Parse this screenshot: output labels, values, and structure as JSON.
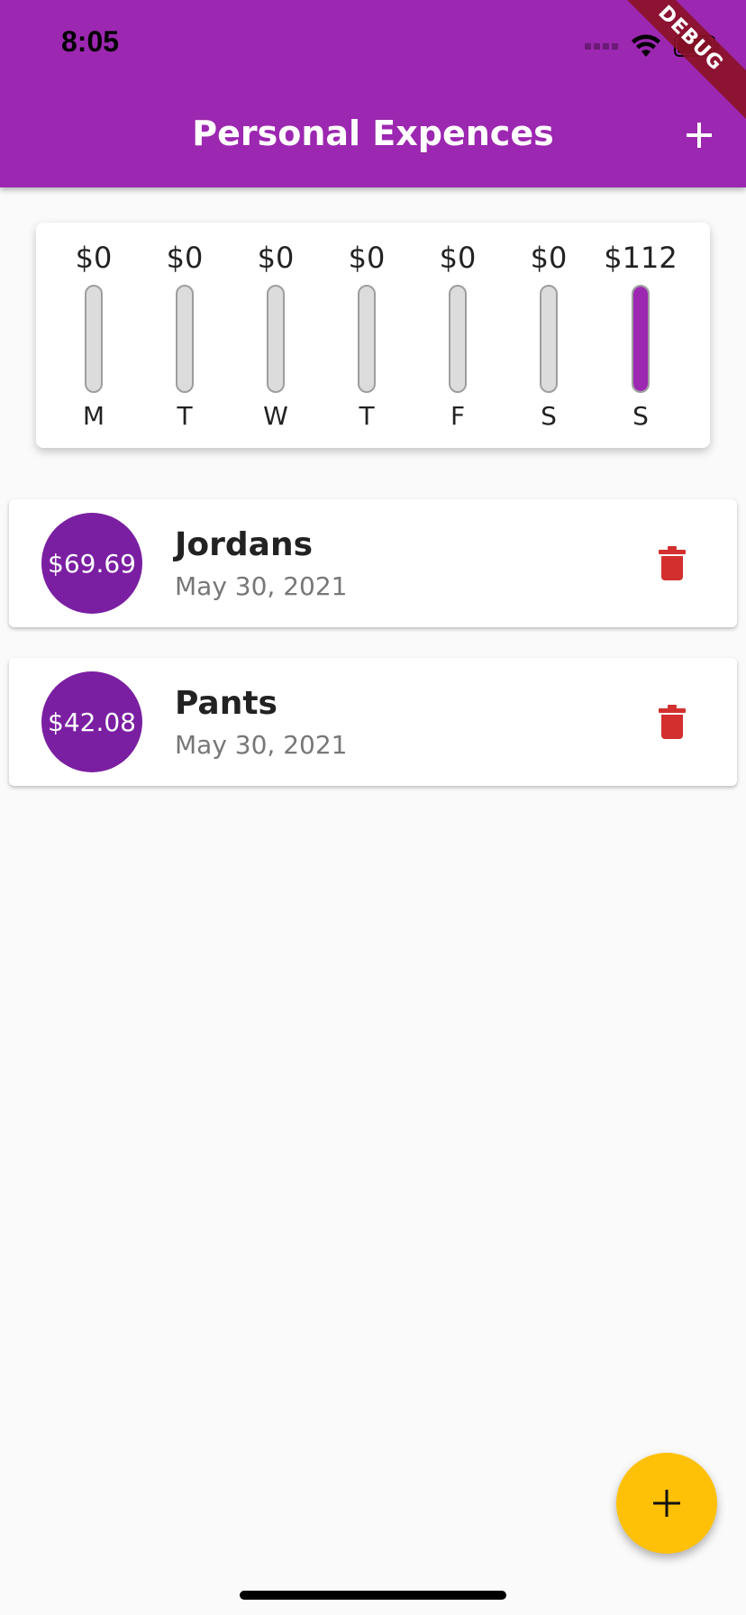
{
  "status_bar": {
    "time": "8:05"
  },
  "app_bar": {
    "title": "Personal Expences",
    "add_icon": "plus-icon"
  },
  "debug_banner": "DEBUG",
  "chart_data": {
    "type": "bar",
    "categories": [
      "M",
      "T",
      "W",
      "T",
      "F",
      "S",
      "S"
    ],
    "value_labels": [
      "$0",
      "$0",
      "$0",
      "$0",
      "$0",
      "$0",
      "$112"
    ],
    "values": [
      0,
      0,
      0,
      0,
      0,
      0,
      112
    ],
    "fill_fraction": [
      0,
      0,
      0,
      0,
      0,
      0,
      1
    ],
    "bar_color": "#9c27b0",
    "track_color": "#dcdcdc"
  },
  "transactions": [
    {
      "amount": "$69.69",
      "title": "Jordans",
      "date": "May 30, 2021",
      "delete_icon": "trash-icon"
    },
    {
      "amount": "$42.08",
      "title": "Pants",
      "date": "May 30, 2021",
      "delete_icon": "trash-icon"
    }
  ],
  "colors": {
    "primary": "#9c27b0",
    "avatar": "#7b1fa2",
    "accent": "#ffc107",
    "delete": "#d32f2f"
  },
  "fab": {
    "icon": "plus-icon"
  }
}
